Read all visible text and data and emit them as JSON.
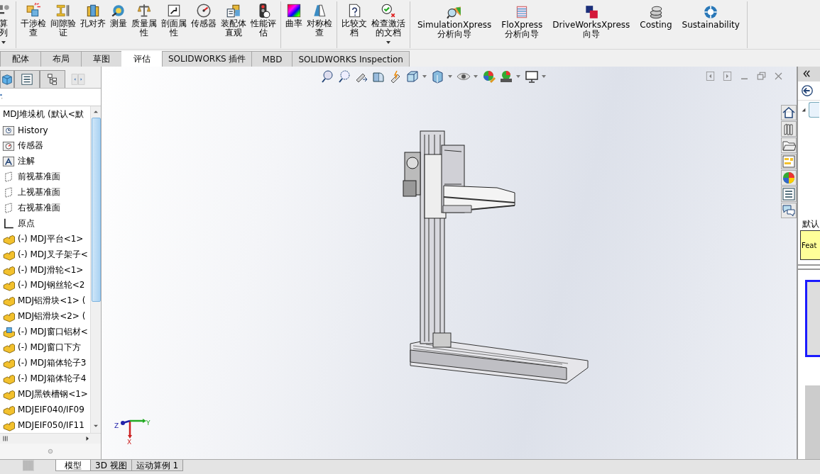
{
  "ribbon": {
    "groups": [
      [
        {
          "lines": [
            "算",
            "列"
          ],
          "dropdown": true
        }
      ],
      [
        {
          "lines": [
            "干涉检",
            "查"
          ],
          "dropdown": false
        },
        {
          "lines": [
            "间隙验",
            "证"
          ],
          "dropdown": false
        },
        {
          "lines": [
            "孔对齐"
          ],
          "dropdown": false
        },
        {
          "lines": [
            "测量"
          ],
          "dropdown": false
        },
        {
          "lines": [
            "质量属",
            "性"
          ],
          "dropdown": false
        },
        {
          "lines": [
            "剖面属",
            "性"
          ],
          "dropdown": false
        },
        {
          "lines": [
            "传感器"
          ],
          "dropdown": false
        },
        {
          "lines": [
            "装配体",
            "直观"
          ],
          "dropdown": false
        },
        {
          "lines": [
            "性能评",
            "估"
          ],
          "dropdown": false
        }
      ],
      [
        {
          "lines": [
            "曲率"
          ],
          "dropdown": false
        },
        {
          "lines": [
            "对称检",
            "查"
          ],
          "dropdown": false
        }
      ],
      [
        {
          "lines": [
            "比较文",
            "档"
          ],
          "dropdown": false
        },
        {
          "lines": [
            "检查激活",
            "的文档"
          ],
          "dropdown": true
        }
      ],
      [
        {
          "lines": [
            "SimulationXpress",
            "分析向导"
          ],
          "dropdown": false
        },
        {
          "lines": [
            "FloXpress",
            "分析向导"
          ],
          "dropdown": false
        },
        {
          "lines": [
            "DriveWorksXpress",
            "向导"
          ],
          "dropdown": false
        },
        {
          "lines": [
            "Costing"
          ],
          "dropdown": false
        },
        {
          "lines": [
            "Sustainability"
          ],
          "dropdown": false
        }
      ]
    ]
  },
  "tabs": [
    {
      "label": "配体",
      "selected": false
    },
    {
      "label": "布局",
      "selected": false
    },
    {
      "label": "草图",
      "selected": false
    },
    {
      "label": "评估",
      "selected": true
    },
    {
      "label": "SOLIDWORKS 插件",
      "selected": false
    },
    {
      "label": "MBD",
      "selected": false
    },
    {
      "label": "SOLIDWORKS Inspection",
      "selected": false
    }
  ],
  "feature_tree": {
    "root": "MDJ堆垛机 (默认<默",
    "items": [
      {
        "kind": "history",
        "label": "History"
      },
      {
        "kind": "sensors",
        "label": "传感器"
      },
      {
        "kind": "annotations",
        "label": "注解"
      },
      {
        "kind": "plane",
        "label": "前视基准面"
      },
      {
        "kind": "plane",
        "label": "上视基准面"
      },
      {
        "kind": "plane",
        "label": "右视基准面"
      },
      {
        "kind": "origin",
        "label": "原点"
      },
      {
        "kind": "part",
        "label": "(-) MDJ平台<1>"
      },
      {
        "kind": "part",
        "label": "(-) MDJ叉子架子<"
      },
      {
        "kind": "part",
        "label": "(-) MDJ滑轮<1>"
      },
      {
        "kind": "part",
        "label": "(-) MDJ钢丝轮<2"
      },
      {
        "kind": "part",
        "label": "MDJ铝滑块<1> ("
      },
      {
        "kind": "part",
        "label": "MDJ铝滑块<2> ("
      },
      {
        "kind": "component",
        "label": "(-) MDJ窗口铝材<"
      },
      {
        "kind": "part",
        "label": "(-) MDJ窗口下方"
      },
      {
        "kind": "part",
        "label": "(-) MDJ箱体轮子3"
      },
      {
        "kind": "part",
        "label": "(-) MDJ箱体轮子4"
      },
      {
        "kind": "part",
        "label": "MDJ黑铁槽钢<1>"
      },
      {
        "kind": "part",
        "label": "MDJEIF040/IF09"
      },
      {
        "kind": "part",
        "label": "MDJEIF050/IF11"
      }
    ]
  },
  "viewport": {
    "triad": {
      "x": "X",
      "y": "Y",
      "z": "Z"
    }
  },
  "task_pane": {
    "config_label": "默认",
    "note": "Feat"
  },
  "bottom_tabs": [
    {
      "label": "模型",
      "selected": true
    },
    {
      "label": "3D 视图",
      "selected": false
    },
    {
      "label": "运动算例 1",
      "selected": false
    }
  ]
}
